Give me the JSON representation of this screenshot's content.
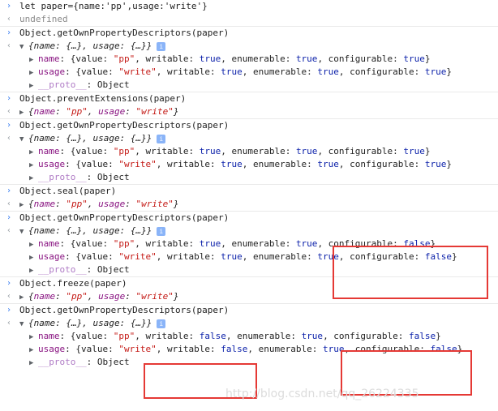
{
  "console": {
    "cmd_let": "let paper={name:'pp',usage:'write'}",
    "undefined": "undefined",
    "cmd_getdesc": "Object.getOwnPropertyDescriptors(paper)",
    "cmd_prevent": "Object.preventExtensions(paper)",
    "cmd_seal": "Object.seal(paper)",
    "cmd_freeze": "Object.freeze(paper)",
    "summary_collapsed": "{name: {…}, usage: {…}}",
    "obj_open": "{",
    "obj_close": "}",
    "name_key": "name",
    "usage_key": "usage",
    "pp": "\"pp\"",
    "write": "\"write\"",
    "comma": ", ",
    "colon": ": ",
    "desc_value_open": ": {value: ",
    "desc_writable": ", writable: ",
    "desc_enumerable": ", enumerable: ",
    "desc_configurable": ", configurable: ",
    "proto_key": "__proto__",
    "proto_val": ": Object",
    "true": "true",
    "false": "false"
  },
  "icons": {
    "prompt_in": "›",
    "prompt_out": "‹",
    "collapsed": "▶",
    "expanded": "▼",
    "info": "i"
  },
  "watermark": "http://blog.csdn.net/qq_26224335",
  "colors": {
    "key": "#881280",
    "string": "#c41a16",
    "boolean": "#0d22aa",
    "highlight": "#e53935",
    "prompt": "#367cf1"
  }
}
